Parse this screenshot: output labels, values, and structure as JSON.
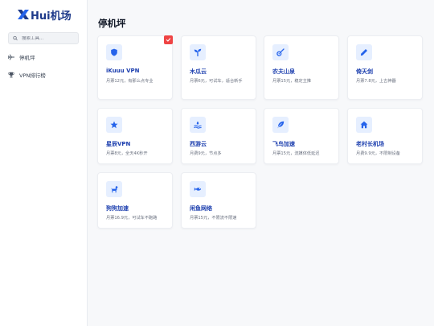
{
  "brand": {
    "name": "Hui机场"
  },
  "search": {
    "placeholder": "搜索工具..."
  },
  "nav": [
    {
      "label": "停机坪",
      "icon": "plane-icon"
    },
    {
      "label": "VPN排行榜",
      "icon": "trophy-icon"
    }
  ],
  "page": {
    "title": "停机坪"
  },
  "colors": {
    "accent": "#2563eb",
    "accent_light": "#e6efff",
    "title_blue": "#1e40af",
    "badge_red": "#ef4444"
  },
  "cards": [
    {
      "name": "iKuuu VPN",
      "desc": "月票12元，有那么点专业",
      "icon": "shield-icon",
      "badge": "check-badge-icon"
    },
    {
      "name": "木瓜云",
      "desc": "月票6元，可试车，适合新手",
      "icon": "sprout-icon"
    },
    {
      "name": "农夫山泉",
      "desc": "月票15元，稳定主推",
      "icon": "guitar-icon"
    },
    {
      "name": "倚天剑",
      "desc": "月票7.8元，上古神器",
      "icon": "pen-icon"
    },
    {
      "name": "星辰VPN",
      "desc": "月票8元，全天4K秒开",
      "icon": "star-icon"
    },
    {
      "name": "西游云",
      "desc": "月费9元，节点多",
      "icon": "water-icon"
    },
    {
      "name": "飞鸟加速",
      "desc": "月票15元，流媒体低延迟",
      "icon": "feather-icon"
    },
    {
      "name": "老村长机场",
      "desc": "月费9.9元，不限制设备",
      "icon": "home-icon"
    },
    {
      "name": "狗狗加速",
      "desc": "月票16.9元，可试车不跑路",
      "icon": "dog-icon"
    },
    {
      "name": "闲鱼网络",
      "desc": "月票15元，不限流不限速",
      "icon": "fish-icon"
    }
  ]
}
